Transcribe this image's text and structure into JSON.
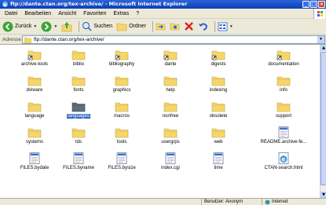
{
  "window": {
    "title": "ftp://dante.ctan.org/tex-archive/ - Microsoft Internet Explorer"
  },
  "menu": [
    "Datei",
    "Bearbeiten",
    "Ansicht",
    "Favoriten",
    "Extras",
    "?"
  ],
  "toolbar": {
    "back_label": "Zurück",
    "search_label": "Suchen",
    "folders_label": "Ordner"
  },
  "address": {
    "label": "Adresse",
    "url": "ftp://dante.ctan.org/tex-archive/"
  },
  "files": [
    {
      "name": "archive-tools",
      "type": "shortcut"
    },
    {
      "name": "biblio",
      "type": "folder"
    },
    {
      "name": "bibliography",
      "type": "shortcut"
    },
    {
      "name": "dante",
      "type": "shortcut"
    },
    {
      "name": "digests",
      "type": "shortcut"
    },
    {
      "name": "documentation",
      "type": "shortcut"
    },
    {
      "name": "dviware",
      "type": "folder"
    },
    {
      "name": "fonts",
      "type": "folder"
    },
    {
      "name": "graphics",
      "type": "folder"
    },
    {
      "name": "help",
      "type": "folder"
    },
    {
      "name": "indexing",
      "type": "folder"
    },
    {
      "name": "info",
      "type": "folder"
    },
    {
      "name": "language",
      "type": "folder"
    },
    {
      "name": "languages",
      "type": "folder-selected"
    },
    {
      "name": "macros",
      "type": "folder"
    },
    {
      "name": "nonfree",
      "type": "folder"
    },
    {
      "name": "obsolete",
      "type": "folder"
    },
    {
      "name": "support",
      "type": "folder"
    },
    {
      "name": "systems",
      "type": "folder"
    },
    {
      "name": "tds",
      "type": "folder"
    },
    {
      "name": "tools",
      "type": "folder"
    },
    {
      "name": "usergrps",
      "type": "folder"
    },
    {
      "name": "web",
      "type": "folder"
    },
    {
      "name": "README.archive-fe...",
      "type": "doc"
    },
    {
      "name": "FILES.bydate",
      "type": "doc"
    },
    {
      "name": "FILES.byname",
      "type": "doc"
    },
    {
      "name": "FILES.bysize",
      "type": "doc"
    },
    {
      "name": "index.cgi",
      "type": "doc"
    },
    {
      "name": "time",
      "type": "doc"
    },
    {
      "name": "CTAN-search.html",
      "type": "html"
    }
  ],
  "status": {
    "user": "Benutzer: Anonym",
    "zone": "Internet"
  },
  "colors": {
    "titlebar": "#0a3fb6",
    "selection": "#316ac5",
    "folder": "#f5d66b"
  }
}
